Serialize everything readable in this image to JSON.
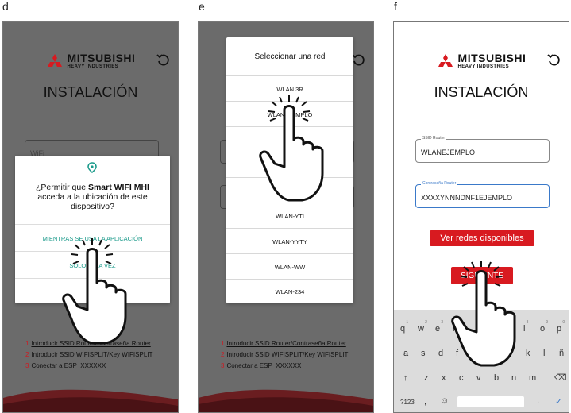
{
  "labels": {
    "d": "d",
    "e": "e",
    "f": "f"
  },
  "brand": {
    "name": "MITSUBISHI",
    "sub": "HEAVY INDUSTRIES"
  },
  "title": "INSTALACIÓN",
  "panel_d": {
    "wifi_field": "WiFi",
    "dialog": {
      "question_pre": "¿Permitir que ",
      "question_bold": "Smart WIFI MHI",
      "question_post": " acceda a la ubicación de este dispositivo?",
      "options": [
        "MIENTRAS SE USA LA APLICACIÓN",
        "SOLO ESTA VEZ",
        ""
      ]
    },
    "steps": [
      {
        "n": "1",
        "text": "Introducir SSID Router/Contraseña Router"
      },
      {
        "n": "2",
        "text": "Introducir SSID WIFISPLIT/Key WIFISPLIT"
      },
      {
        "n": "3",
        "text": "Conectar a ESP_XXXXXX"
      }
    ]
  },
  "panel_e": {
    "header": "Seleccionar una red",
    "networks": [
      "WLAN 3R",
      "WLANEJEMPLO",
      "WL",
      "",
      "WL",
      "WLAN-YTI",
      "WLAN-YYTY",
      "WLAN-WW",
      "WLAN-234"
    ],
    "steps": [
      {
        "n": "1",
        "text": "Introducir SSID Router/Contraseña Router"
      },
      {
        "n": "2",
        "text": "Introducir SSID WIFISPLIT/Key WIFISPLIT"
      },
      {
        "n": "3",
        "text": "Conectar a ESP_XXXXXX"
      }
    ]
  },
  "panel_f": {
    "ssid_label": "SSID Router",
    "ssid_value": "WLANEJEMPLO",
    "pass_label": "Contraseña Router",
    "pass_value": "XXXXYNNNDNF1EJEMPLO",
    "networks_button": "Ver redes disponibles",
    "next_button": "SIGUIENTE",
    "keyboard": {
      "row1": [
        "q",
        "w",
        "e",
        "r",
        "t",
        "y",
        "u",
        "i",
        "o",
        "p"
      ],
      "row1_nums": [
        "1",
        "2",
        "3",
        "4",
        "5",
        "6",
        "7",
        "8",
        "9",
        "0"
      ],
      "row2": [
        "a",
        "s",
        "d",
        "f",
        "g",
        "h",
        "j",
        "k",
        "l",
        "ñ"
      ],
      "row3": [
        "z",
        "x",
        "c",
        "v",
        "b",
        "n",
        "m"
      ],
      "symbols": "?123",
      "comma": ",",
      "period": "."
    }
  },
  "colors": {
    "accent_red": "#d81a20",
    "dialog_teal": "#1a9a8a",
    "focus_blue": "#3a79c9"
  }
}
